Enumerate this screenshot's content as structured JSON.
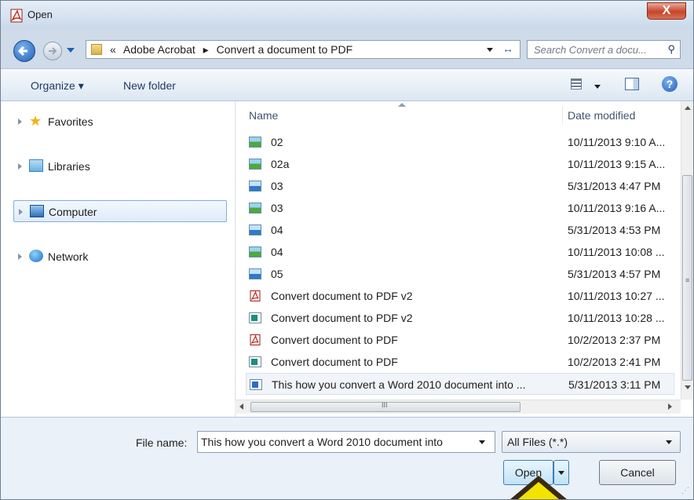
{
  "window": {
    "title": "Open",
    "close_label": "X"
  },
  "navigation": {
    "breadcrumbs": [
      "«",
      "Adobe Acrobat",
      "▸",
      "Convert a document to PDF"
    ],
    "search_placeholder": "Search Convert a docu..."
  },
  "toolbar": {
    "organize_label": "Organize ▾",
    "new_folder_label": "New folder",
    "help_label": "?"
  },
  "sidebar": {
    "items": [
      {
        "label": "Favorites",
        "icon": "star-icon"
      },
      {
        "label": "Libraries",
        "icon": "library-icon"
      },
      {
        "label": "Computer",
        "icon": "computer-icon",
        "selected": true
      },
      {
        "label": "Network",
        "icon": "network-icon"
      }
    ]
  },
  "file_list": {
    "columns": {
      "name": "Name",
      "date": "Date modified"
    },
    "rows": [
      {
        "name": "02",
        "date": "10/11/2013 9:10 A...",
        "icon": "image-icon"
      },
      {
        "name": "02a",
        "date": "10/11/2013 9:15 A...",
        "icon": "image-icon"
      },
      {
        "name": "03",
        "date": "5/31/2013 4:47 PM",
        "icon": "png-icon"
      },
      {
        "name": "03",
        "date": "10/11/2013 9:16 A...",
        "icon": "image-icon"
      },
      {
        "name": "04",
        "date": "5/31/2013 4:53 PM",
        "icon": "png-icon"
      },
      {
        "name": "04",
        "date": "10/11/2013 10:08 ...",
        "icon": "image-icon"
      },
      {
        "name": "05",
        "date": "5/31/2013 4:57 PM",
        "icon": "png-icon"
      },
      {
        "name": "Convert document to PDF v2",
        "date": "10/11/2013 10:27 ...",
        "icon": "pdf-icon"
      },
      {
        "name": "Convert document to PDF v2",
        "date": "10/11/2013 10:28 ...",
        "icon": "publisher-icon"
      },
      {
        "name": "Convert document to PDF",
        "date": "10/2/2013 2:37 PM",
        "icon": "pdf-icon"
      },
      {
        "name": "Convert document to PDF",
        "date": "10/2/2013 2:41 PM",
        "icon": "publisher-icon"
      },
      {
        "name": "This how you convert a Word 2010 document into ...",
        "date": "5/31/2013 3:11 PM",
        "icon": "word-doc-icon",
        "selected": true
      }
    ]
  },
  "footer": {
    "file_name_label": "File name:",
    "file_name_value": "This how you convert a Word 2010 document into",
    "file_type_value": "All Files (*.*)",
    "open_label": "Open",
    "cancel_label": "Cancel"
  },
  "scrollbar_glyphs": {
    "vertical_grip": "≡",
    "horizontal_grip": "III"
  },
  "colors": {
    "accent": "#1f5fb8",
    "close": "#c7442a",
    "selection": "#dfecf9",
    "pointer": "#f3e400"
  }
}
